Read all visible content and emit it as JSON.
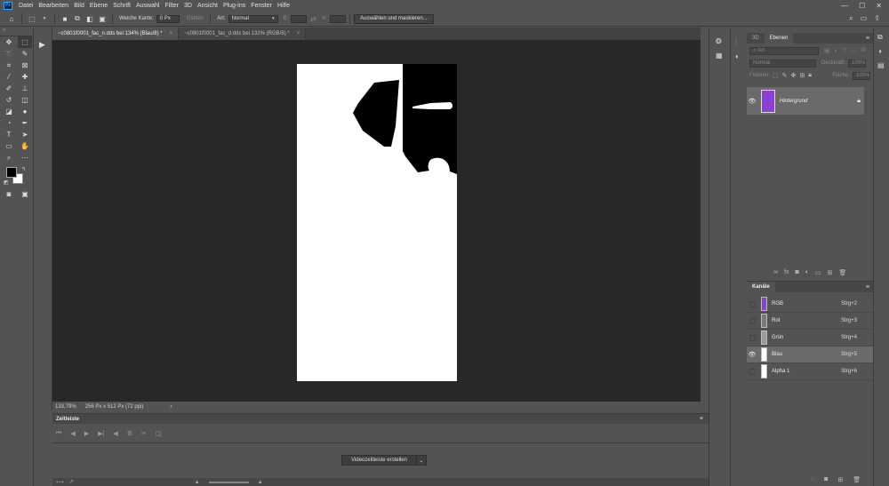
{
  "menubar": {
    "logo": "Ps",
    "items": [
      "Datei",
      "Bearbeiten",
      "Bild",
      "Ebene",
      "Schrift",
      "Auswahl",
      "Filter",
      "3D",
      "Ansicht",
      "Plug-ins",
      "Fenster",
      "Hilfe"
    ]
  },
  "options": {
    "feather_label": "Weiche Kante:",
    "feather_value": "0 Px",
    "smooth_label": "Glätten",
    "style_label": "Art:",
    "style_value": "Normal",
    "width_label": "B:",
    "height_label": "H:",
    "select_mask_button": "Auswählen und maskieren..."
  },
  "tabs": [
    {
      "label": "~c0801f0001_fac_n.dds bei 134% (Blau/8) *",
      "close": "×"
    },
    {
      "label": "~c0801f0001_fac_d.dds bei 132% (RGB/8) *",
      "close": "×"
    }
  ],
  "status": {
    "zoom": "133,79%",
    "doc_info": "256 Px x 512 Px (72 ppi)",
    "arrow": "›"
  },
  "timeline": {
    "title": "Zeitleiste",
    "create_button": "Videozeitleiste erstellen"
  },
  "layers": {
    "tab_3d": "3D",
    "tab_layers": "Ebenen",
    "filter_placeholder": "Art",
    "blend_mode": "Normal",
    "opacity_label": "Deckkraft:",
    "opacity_value": "100%",
    "lock_label": "Fixieren:",
    "fill_label": "Fläche:",
    "fill_value": "100%",
    "layer_name": "Hintergrund"
  },
  "channels": {
    "title": "Kanäle",
    "items": [
      {
        "name": "RGB",
        "shortcut": "Strg+2",
        "thumb": "#8a3fd8"
      },
      {
        "name": "Rot",
        "shortcut": "Strg+3",
        "thumb": "#7a7a7a"
      },
      {
        "name": "Grün",
        "shortcut": "Strg+4",
        "thumb": "#9a9a9a"
      },
      {
        "name": "Blau",
        "shortcut": "Strg+5",
        "thumb": "#ffffff"
      },
      {
        "name": "Alpha 1",
        "shortcut": "Strg+6",
        "thumb": "#ffffff"
      }
    ]
  },
  "colors": {
    "accent": "#31a8ff",
    "ui_bg": "#535353",
    "canvas_bg": "#282828"
  }
}
